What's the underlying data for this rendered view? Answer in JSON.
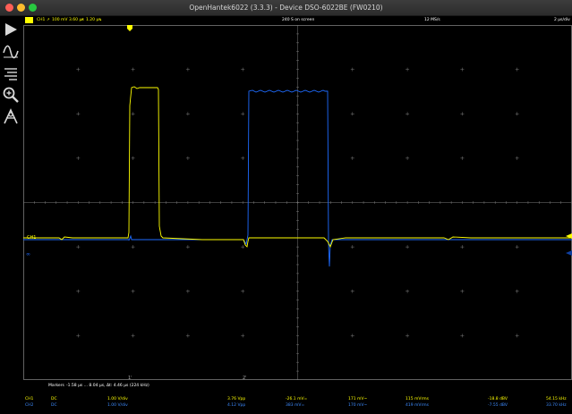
{
  "window": {
    "title": "OpenHantek6022 (3.3.3) - Device DSO-6022BE (FW0210)"
  },
  "toolbar": {
    "tools": [
      {
        "icon": "play-icon"
      },
      {
        "icon": "sine-wave-icon"
      },
      {
        "icon": "measure-lines-icon"
      },
      {
        "icon": "zoom-icon"
      },
      {
        "icon": "cursor-measure-icon"
      }
    ]
  },
  "status": {
    "ch1_tag": "CH1",
    "ch1_label": "CH1",
    "ch1_coupling": "↗",
    "ch1_scale": "100 mV",
    "ch1_trigger": "3.60 µs",
    "ch1_edge": "↗",
    "ch1_time": "1.20 µs",
    "ch1_slope": "↘",
    "on_screen": "240 S on screen",
    "sample_rate": "12 MS/s",
    "timebase": "2 µs/div"
  },
  "scope": {
    "ch1_marker_label": "CH1",
    "ch2_marker_label": "CH2",
    "marker1": "1'",
    "marker2": "2'",
    "colors": {
      "background": "#000000",
      "grid": "#7a7a7a",
      "ch1": "#ffff00",
      "ch2": "#1e6bff",
      "ch2_marker": "#0f3fa0",
      "trigger": "#ffff00"
    }
  },
  "markers_info": {
    "label": "Markers",
    "text": "-1.58 µs ... 8.04 µs,  Δt: 4.46 µs (224 kHz)"
  },
  "measurements": {
    "ch1": {
      "name": "CH1",
      "coupling": "DC",
      "scale": "1.00 V/div",
      "vpp": "3.76 Vpp",
      "dc": "-26.1 mV=",
      "ac": "171 mV~",
      "rms": "115 mVrms",
      "dbv": "-18.8 dBV",
      "freq": "54.15 kHz"
    },
    "ch2": {
      "name": "CH2",
      "coupling": "DC",
      "scale": "1.00 V/div",
      "vpp": "4.12 Vpp",
      "dc": "383 mV=",
      "ac": "170 mV~",
      "rms": "419 mVrms",
      "dbv": "-7.55 dBV",
      "freq": "33.70 kHz"
    }
  }
}
